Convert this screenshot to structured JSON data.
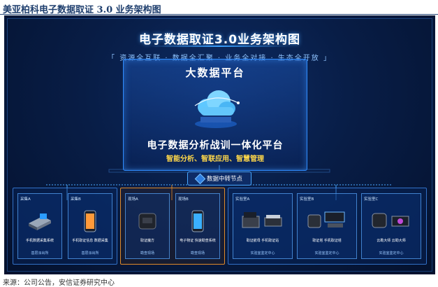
{
  "figure_caption": "美亚柏科电子数据取证 3.0 业务架构图",
  "diagram": {
    "title": "电子数据取证3.0业务架构图",
    "slogan": "「 资源全互联 · 数据全汇聚 · 业务全对接 · 生态全开放 」",
    "platform": {
      "header": "大数据平台",
      "name": "电子数据分析战训一体化平台",
      "subtitle": "智能分析、智联应用、智慧管理"
    },
    "node": "数据中转节点",
    "groups": [
      {
        "style": "blue",
        "cards": [
          {
            "tag": "采集A",
            "label": "手机数据采集系统",
            "foot": "基层派出所"
          },
          {
            "tag": "采集B",
            "label": "手机取证信息 数据采集",
            "foot": "基层派出所"
          }
        ]
      },
      {
        "style": "orange",
        "cards": [
          {
            "tag": "现场A",
            "label": "取证魔方",
            "foot": "勘查现场"
          },
          {
            "tag": "现场B",
            "label": "电子物证 快速勘查系统",
            "foot": "勘查现场"
          }
        ]
      },
      {
        "style": "blue",
        "cards": [
          {
            "tag": "实验室A",
            "label": "取证航母    手机取证站",
            "foot": "实验室鉴定中心"
          },
          {
            "tag": "实验室B",
            "label": "取证塔    手机取证塔",
            "foot": "实验室鉴定中心"
          },
          {
            "tag": "实验室C",
            "label": "云勘大师    云勘大师",
            "foot": "实验室鉴定中心"
          }
        ]
      }
    ]
  },
  "source": "来源：公司公告，安信证券研究中心",
  "colors": {
    "background": "#081d46",
    "accent": "#2f8cff",
    "highlight": "#ffd84a",
    "orange_frame": "#e08a2a"
  }
}
